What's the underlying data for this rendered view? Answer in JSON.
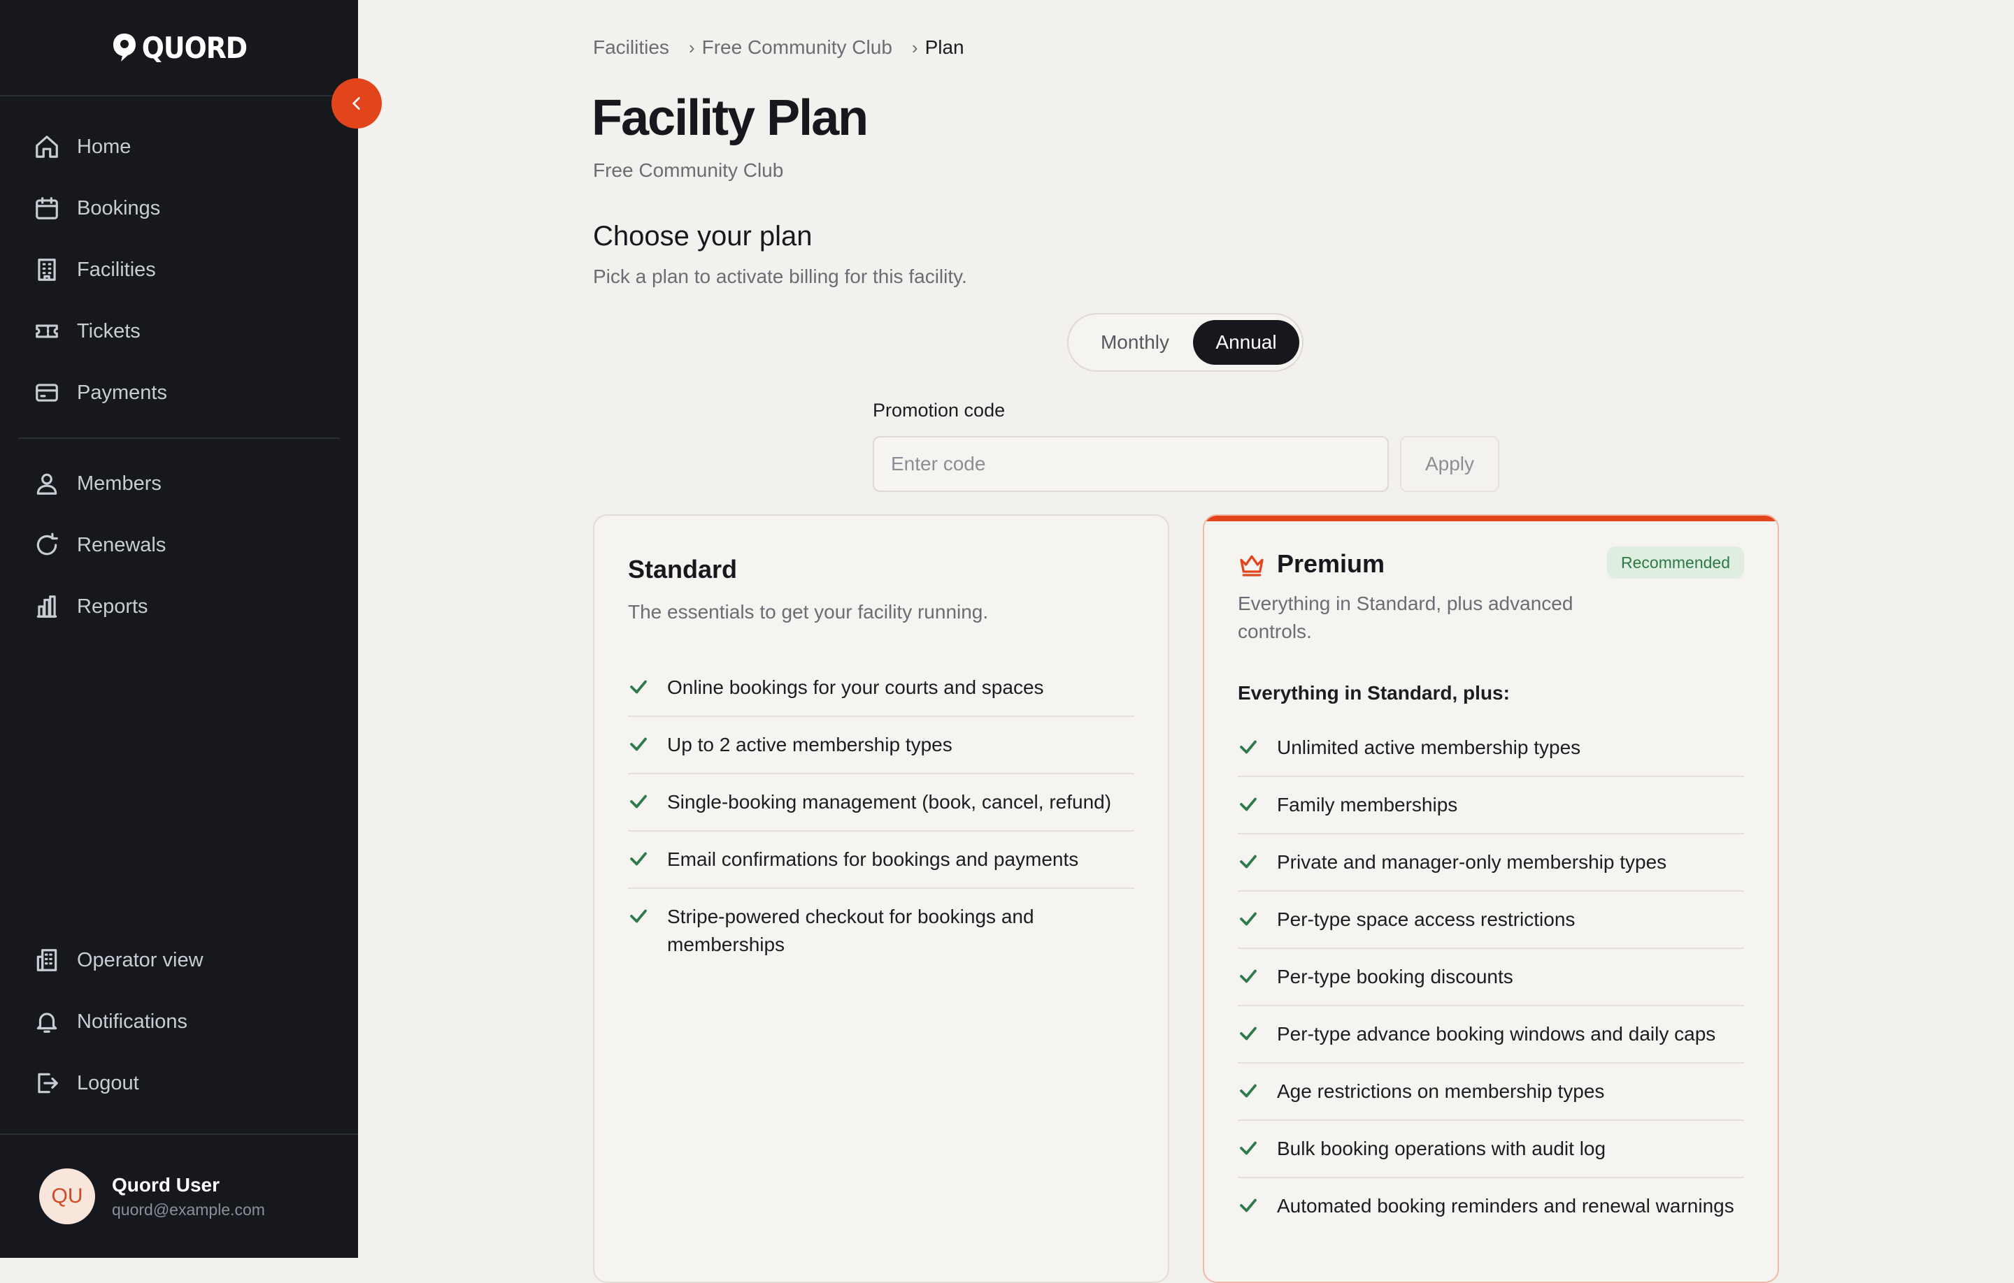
{
  "brand": {
    "name": "QUORD"
  },
  "sidebar": {
    "collapse_icon": "chevron-left-icon",
    "primary": [
      {
        "label": "Home",
        "icon": "home-icon"
      },
      {
        "label": "Bookings",
        "icon": "calendar-icon"
      },
      {
        "label": "Facilities",
        "icon": "building-icon"
      },
      {
        "label": "Tickets",
        "icon": "ticket-icon"
      },
      {
        "label": "Payments",
        "icon": "credit-card-icon"
      }
    ],
    "secondary": [
      {
        "label": "Members",
        "icon": "users-icon"
      },
      {
        "label": "Renewals",
        "icon": "refresh-icon"
      },
      {
        "label": "Reports",
        "icon": "bar-chart-icon"
      }
    ],
    "footer": [
      {
        "label": "Operator view",
        "icon": "operator-building-icon"
      },
      {
        "label": "Notifications",
        "icon": "bell-icon"
      },
      {
        "label": "Logout",
        "icon": "logout-icon"
      }
    ],
    "user": {
      "initials": "QU",
      "name": "Quord User",
      "email": "quord@example.com"
    }
  },
  "breadcrumb": {
    "items": [
      "Facilities",
      "Free Community Club",
      "Plan"
    ]
  },
  "page": {
    "title": "Facility Plan",
    "subtitle": "Free Community Club"
  },
  "plan_section": {
    "title": "Choose your plan",
    "description": "Pick a plan to activate billing for this facility.",
    "billing_toggle": {
      "monthly": "Monthly",
      "annual": "Annual",
      "selected": "Annual"
    }
  },
  "promo": {
    "label": "Promotion code",
    "placeholder": "Enter code",
    "apply": "Apply"
  },
  "plans": {
    "standard": {
      "name": "Standard",
      "description": "The essentials to get your facility running.",
      "features": [
        "Online bookings for your courts and spaces",
        "Up to 2 active membership types",
        "Single-booking management (book, cancel, refund)",
        "Email confirmations for bookings and payments",
        "Stripe-powered checkout for bookings and memberships"
      ]
    },
    "premium": {
      "name": "Premium",
      "icon": "crown-icon",
      "badge": "Recommended",
      "description": "Everything in Standard, plus advanced controls.",
      "features_heading": "Everything in Standard, plus:",
      "features": [
        "Unlimited active membership types",
        "Family memberships",
        "Private and manager-only membership types",
        "Per-type space access restrictions",
        "Per-type booking discounts",
        "Per-type advance booking windows and daily caps",
        "Age restrictions on membership types",
        "Bulk booking operations with audit log",
        "Automated booking reminders and renewal warnings"
      ]
    }
  },
  "colors": {
    "accent": "#e2441c",
    "sidebar_bg": "#16181d",
    "check": "#2d7a4a",
    "badge_bg": "#e0eee2"
  }
}
